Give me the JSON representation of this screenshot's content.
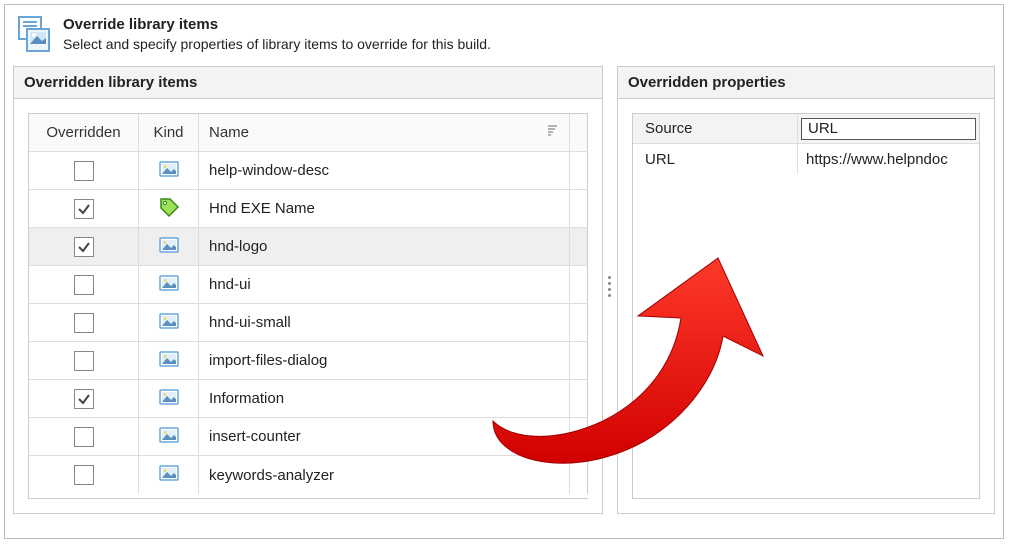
{
  "header": {
    "title": "Override library items",
    "subtitle": "Select and specify properties of library items to override for this build."
  },
  "leftPanel": {
    "title": "Overridden library items",
    "columns": {
      "overridden": "Overridden",
      "kind": "Kind",
      "name": "Name"
    },
    "rows": [
      {
        "checked": false,
        "kind": "image",
        "name": "help-window-desc",
        "selected": false
      },
      {
        "checked": true,
        "kind": "tag",
        "name": "Hnd EXE Name",
        "selected": false
      },
      {
        "checked": true,
        "kind": "image",
        "name": "hnd-logo",
        "selected": true
      },
      {
        "checked": false,
        "kind": "image",
        "name": "hnd-ui",
        "selected": false
      },
      {
        "checked": false,
        "kind": "image",
        "name": "hnd-ui-small",
        "selected": false
      },
      {
        "checked": false,
        "kind": "image",
        "name": "import-files-dialog",
        "selected": false
      },
      {
        "checked": true,
        "kind": "image",
        "name": "Information",
        "selected": false
      },
      {
        "checked": false,
        "kind": "image",
        "name": "insert-counter",
        "selected": false
      },
      {
        "checked": false,
        "kind": "image",
        "name": "keywords-analyzer",
        "selected": false
      }
    ]
  },
  "rightPanel": {
    "title": "Overridden properties",
    "props": [
      {
        "label": "Source",
        "value": "URL",
        "header": true
      },
      {
        "label": "URL",
        "value": "https://www.helpndoc",
        "header": false
      }
    ]
  }
}
